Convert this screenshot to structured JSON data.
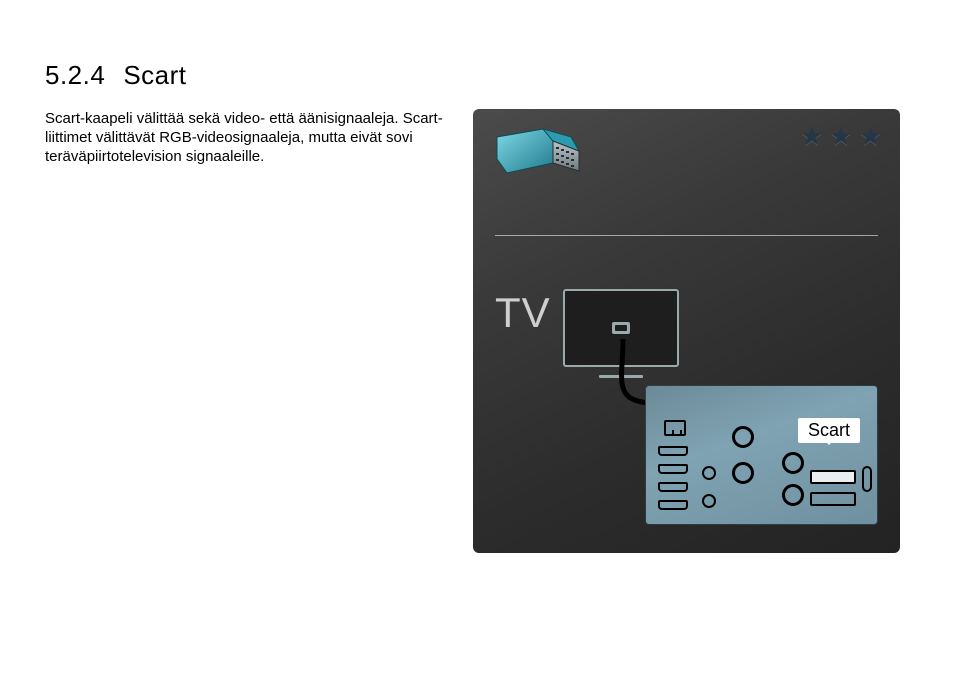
{
  "section": {
    "number": "5.2.4",
    "title": "Scart"
  },
  "body": "Scart-kaapeli välittää sekä video- että äänisignaaleja. Scart-liittimet välittävät RGB-videosignaaleja, mutta eivät sovi teräväpiirtotelevision signaaleille.",
  "figure": {
    "rating_stars": 3,
    "tv_label": "TV",
    "callout_label": "Scart"
  }
}
